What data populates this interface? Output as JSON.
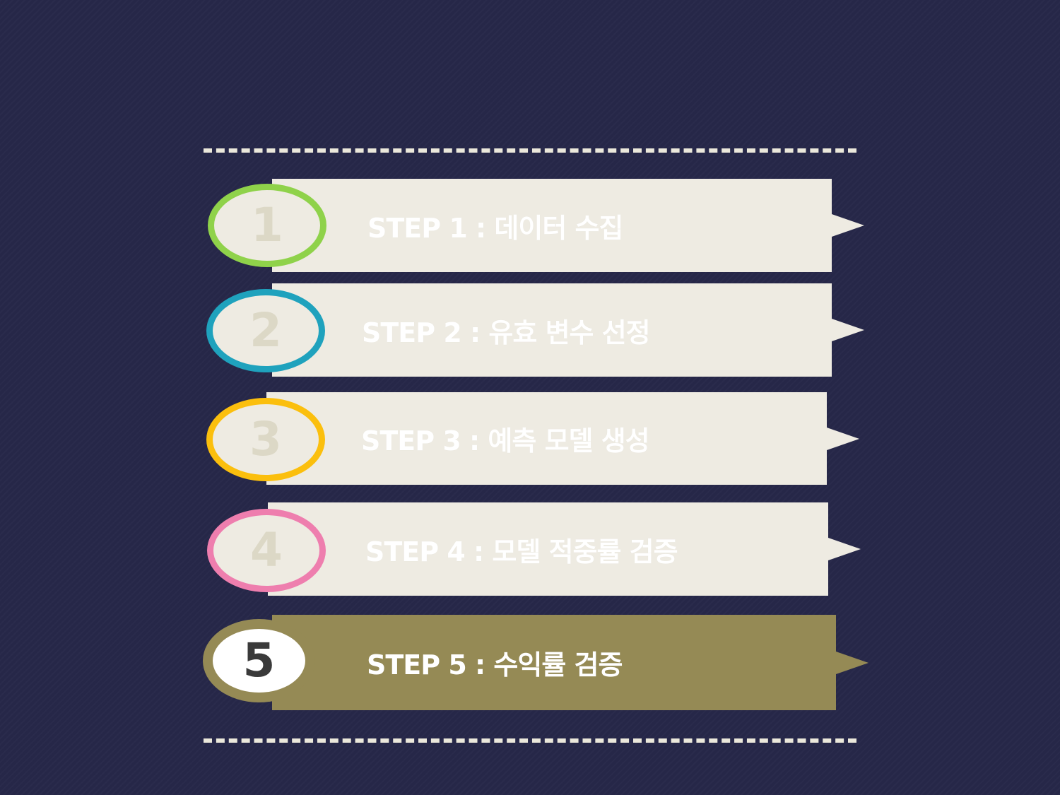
{
  "steps": [
    {
      "number": "1",
      "label": "STEP 1 : 데이터 수집",
      "ring_color": "#8fd24a",
      "active": false
    },
    {
      "number": "2",
      "label": "STEP 2 : 유효 변수 선정",
      "ring_color": "#1fa2bd",
      "active": false
    },
    {
      "number": "3",
      "label": "STEP 3 : 예측 모델 생성",
      "ring_color": "#fbbf0d",
      "active": false
    },
    {
      "number": "4",
      "label": "STEP 4 : 모델 적중률 검증",
      "ring_color": "#ee7eae",
      "active": false
    },
    {
      "number": "5",
      "label": "STEP 5 : 수익률 검증",
      "ring_color": "#958a55",
      "active": true
    }
  ],
  "colors": {
    "background": "#262748",
    "banner": "#eeebe2",
    "active_banner": "#958a55",
    "dashed_line": "#ebe8db"
  }
}
